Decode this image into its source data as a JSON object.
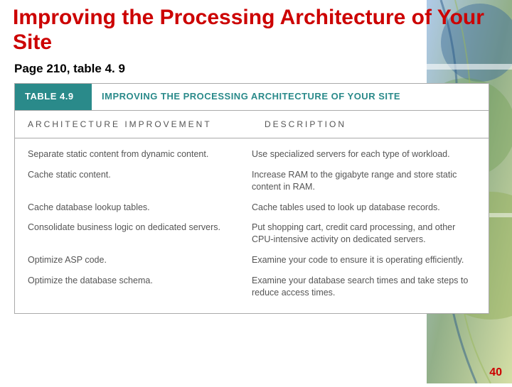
{
  "slide": {
    "title": "Improving the Processing Architecture of Your Site",
    "subtitle": "Page 210, table 4. 9",
    "page_number": "40"
  },
  "table": {
    "number_label": "TABLE 4.9",
    "title": "IMPROVING THE PROCESSING ARCHITECTURE OF YOUR SITE",
    "columns": [
      "ARCHITECTURE IMPROVEMENT",
      "DESCRIPTION"
    ],
    "rows": [
      {
        "improvement": "Separate static content from dynamic content.",
        "description": "Use specialized servers for each type of workload."
      },
      {
        "improvement": "Cache static content.",
        "description": "Increase RAM to the gigabyte range and store static content in RAM."
      },
      {
        "improvement": "Cache database lookup tables.",
        "description": "Cache tables used to look up database records."
      },
      {
        "improvement": "Consolidate business logic on dedicated servers.",
        "description": "Put shopping cart, credit card processing, and other CPU-intensive activity on dedicated servers."
      },
      {
        "improvement": "Optimize ASP code.",
        "description": "Examine your code to ensure it is operating efficiently."
      },
      {
        "improvement": "Optimize the database schema.",
        "description": "Examine your database search times and take steps to reduce access times."
      }
    ]
  }
}
